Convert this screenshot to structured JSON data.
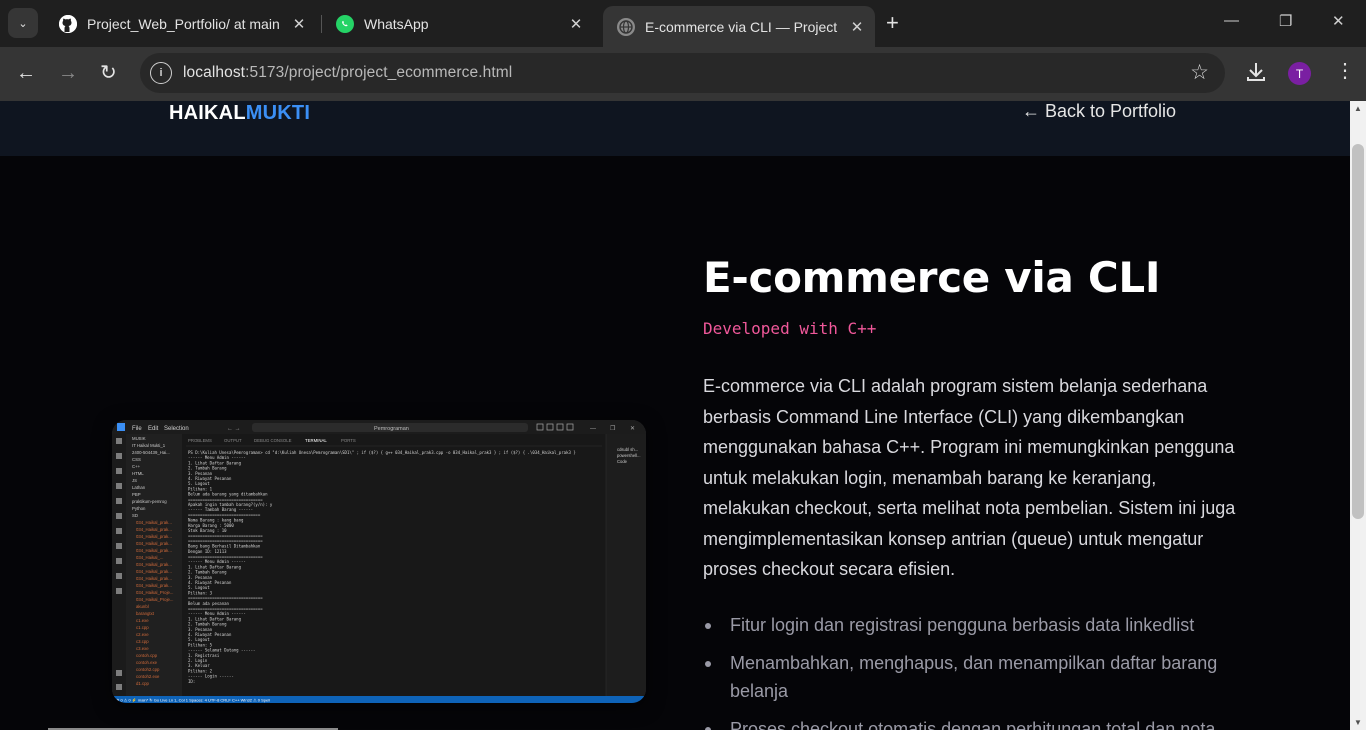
{
  "browser": {
    "tabs": [
      {
        "title": "Project_Web_Portfolio/ at main",
        "icon": "github-icon"
      },
      {
        "title": "WhatsApp",
        "icon": "whatsapp-icon"
      },
      {
        "title": "E-commerce via CLI — Project D",
        "icon": "globe-icon",
        "active": true
      }
    ],
    "url_host": "localhost",
    "url_rest": ":5173/project/project_ecommerce.html",
    "profile_initial": "T",
    "accent_color": "#7a1fa2"
  },
  "site": {
    "logo_primary": "HAIKAL",
    "logo_accent": "MUKTI",
    "accent_color": "#3b8ff5",
    "back_link": "← Back to Portfolio"
  },
  "project": {
    "title": "E-commerce via CLI",
    "subtitle": "Developed with C++",
    "subtitle_color": "#f0589a",
    "description": "E-commerce via CLI adalah program sistem belanja sederhana berbasis Command Line Interface (CLI) yang dikembangkan menggunakan bahasa C++. Program ini memungkinkan pengguna untuk melakukan login, menambah barang ke keranjang, melakukan checkout, serta melihat nota pembelian. Sistem ini juga mengimplementasikan konsep antrian (queue) untuk mengatur proses checkout secara efisien.",
    "features": [
      "Fitur login dan registrasi pengguna berbasis data linkedlist",
      "Menambahkan, menghapus, dan menampilkan daftar barang belanja",
      "Proses checkout otomatis dengan perhitungan total dan nota"
    ]
  },
  "screenshot": {
    "menu": [
      "File",
      "Edit",
      "Selection"
    ],
    "search": "Pemrograman",
    "panel_tabs": [
      "PROBLEMS",
      "OUTPUT",
      "DEBUG CONSOLE",
      "TERMINAL",
      "PORTS"
    ],
    "terminal_lines": [
      "PS D:\\Kuliah Unesa\\Pemrograman> cd \"d:\\Kuliah Unesa\\Pemrograman\\SD1\\\" ; if ($?) { g++ 034_Haikal_prak3.cpp -o 034_Haikal_prak3 } ; if ($?) { .\\034_Haikal_prak3 }",
      "------ Menu Admin ------",
      "1. Lihat Daftar Barang",
      "2. Tambah Barang",
      "3. Pesanan",
      "4. Riwayat Pesanan",
      "5. Logout",
      "Pilihan: 1",
      "Belum ada barang yang ditambahkan",
      "===============================",
      "Apakah ingin tambah barang?(y/n): y",
      "------ Tambah Barang ------",
      "==============================",
      "Nama Barang   : kang bang",
      "Harga Barang  : 5000",
      "Stok Barang   : 10",
      "===============================",
      "===============================",
      "Bang bang Berhasil Ditambahkan",
      "Dengan ID: 12113",
      "===============================",
      "------ Menu Admin ------",
      "1. Lihat Daftar Barang",
      "2. Tambah Barang",
      "3. Pesanan",
      "4. Riwayat Pesanan",
      "5. Logout",
      "Pilihan: 3",
      "===============================",
      "Belum ada pesanan",
      "===============================",
      "------ Menu Admin ------",
      "1. Lihat Daftar Barang",
      "2. Tambah Barang",
      "3. Pesanan",
      "4. Riwayat Pesanan",
      "5. Logout",
      "Pilihan: 5",
      "------ Selamat Datang ------",
      "1. Registrasi",
      "2. Login",
      "3. Keluar",
      "Pilihan: 2",
      "------ Login ------",
      "ID: "
    ],
    "explorer": [
      "MUSIK",
      "IT Haikal Mukti_1",
      "2400-504439_Hai...",
      "CSS",
      "C++",
      "HTML",
      "JS",
      "Lathan",
      "PBP",
      "praktikum-pemrog",
      "Python",
      "SD",
      "034_Haikal_prak...",
      "034_Haikal_prak...",
      "034_Haikal_prak...",
      "034_Haikal_prak...",
      "034_Haikal_prak...",
      "034_Haikal_...",
      "034_Haikal_prak...",
      "034_Haikal_prak...",
      "034_Haikal_prak...",
      "034_Haikal_prak...",
      "034_Haikal_Proje...",
      "034_Haikal_Proje...",
      "akunbl",
      "barangtxt",
      "c1.exe",
      "c1.cpp",
      "c2.exe",
      "c3.cpp",
      "c3.exe",
      "contoh.cpp",
      "contoh.exe",
      "contoh2.cpp",
      "contoh2.exe",
      "d1.cpp"
    ],
    "side_panel": [
      "cdsubl sh...",
      "powershell...",
      "Code"
    ]
  }
}
